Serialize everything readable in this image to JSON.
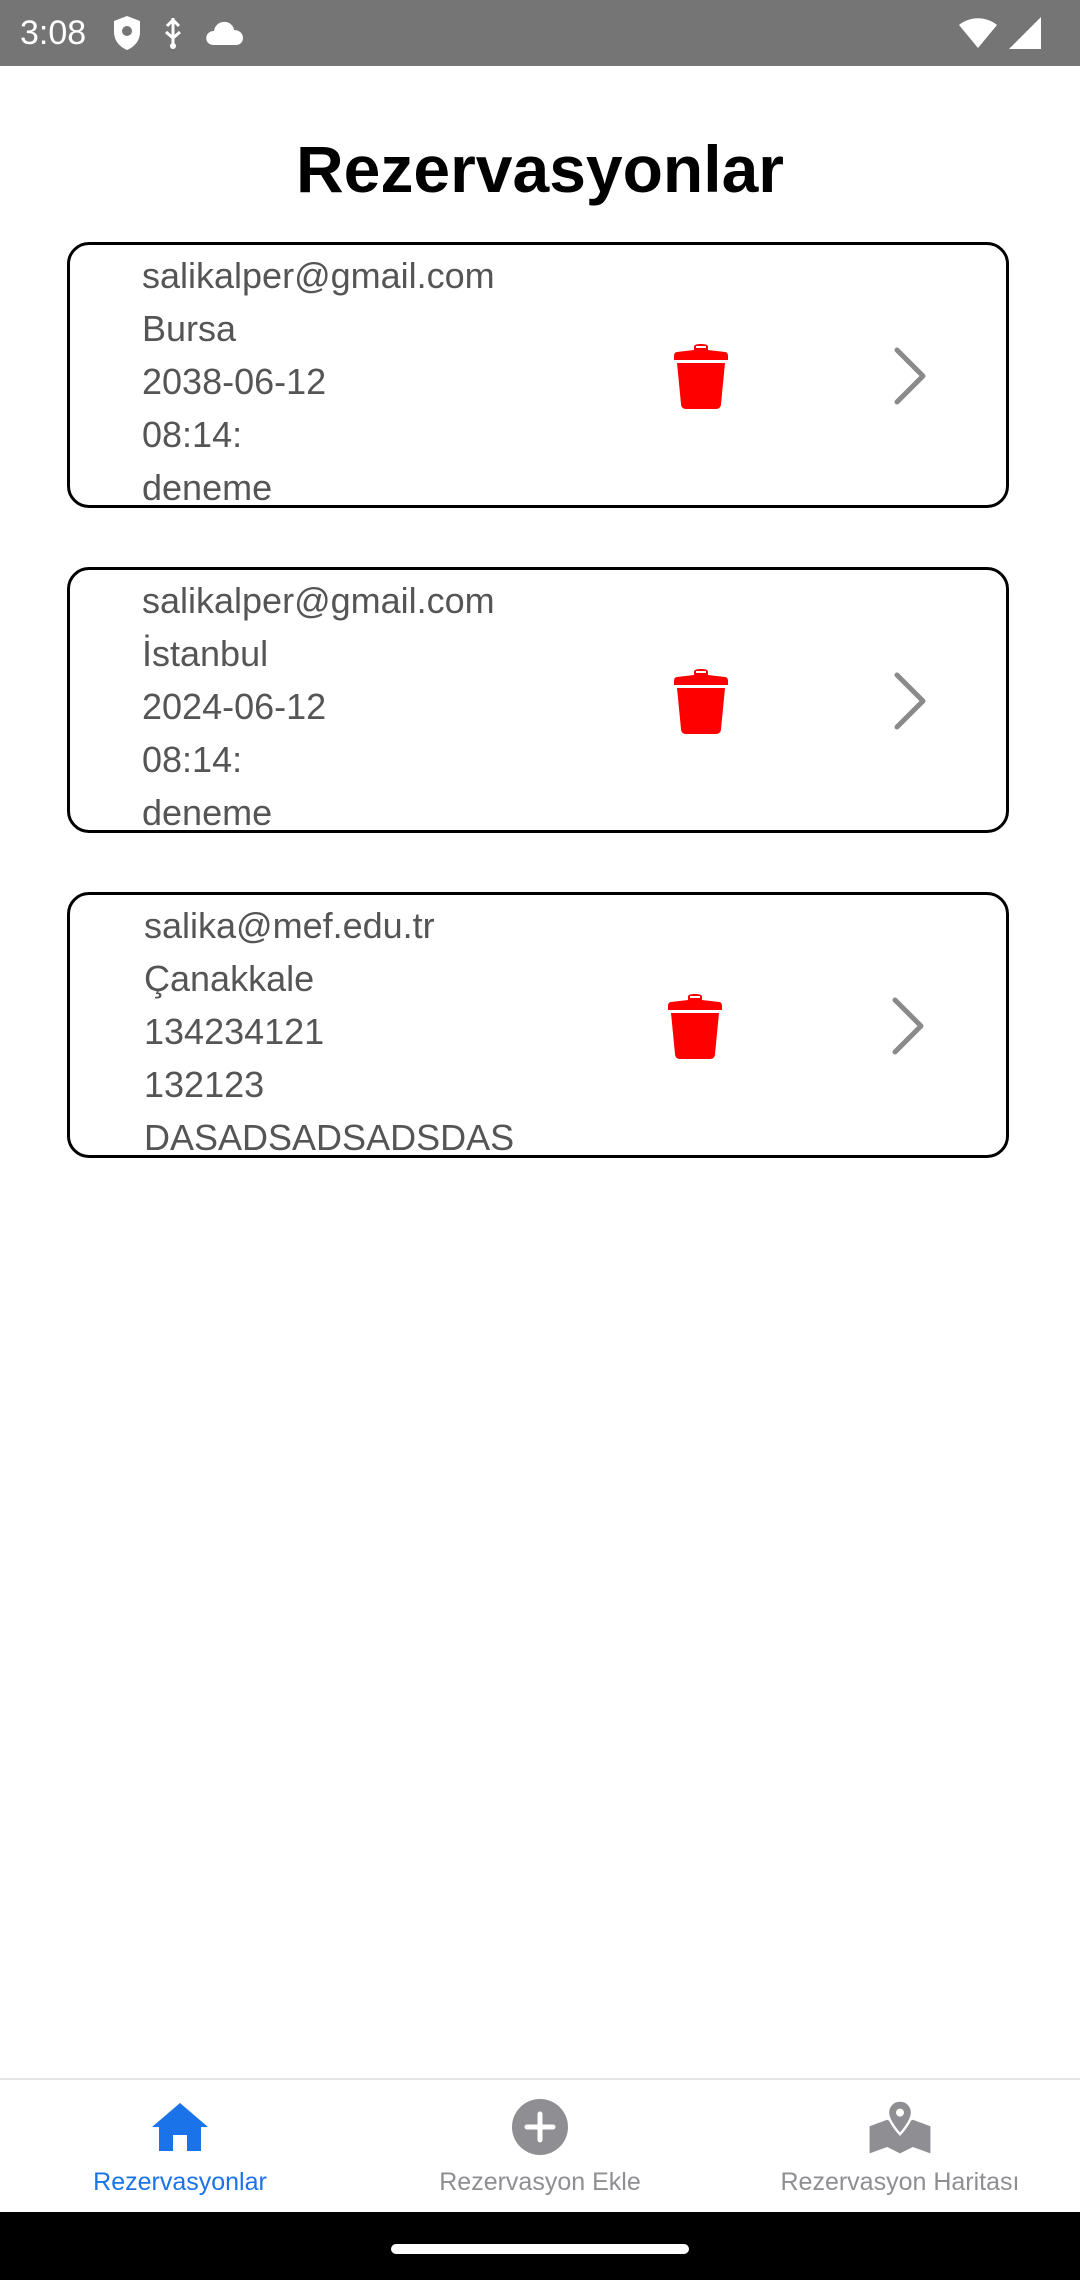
{
  "status_bar": {
    "time": "3:08",
    "icons_left": [
      "shield-icon",
      "usb-debug-icon",
      "cloud-icon"
    ],
    "icons_right": [
      "wifi-icon",
      "cellular-signal-icon"
    ]
  },
  "page": {
    "title": "Rezervasyonlar"
  },
  "reservations": [
    {
      "email": "salikalper@gmail.com",
      "city": "Bursa",
      "date": "2038-06-12",
      "time": "08:14:",
      "note": "deneme"
    },
    {
      "email": "salikalper@gmail.com",
      "city": "İstanbul",
      "date": "2024-06-12",
      "time": "08:14:",
      "note": "deneme"
    },
    {
      "email": "salika@mef.edu.tr",
      "city": "Çanakkale",
      "date": "134234121",
      "time": "132123",
      "note": "DASADSADSADSDAS"
    }
  ],
  "card_icons": {
    "delete": "trash-icon",
    "open": "chevron-right-icon"
  },
  "bottom_nav": {
    "items": [
      {
        "label": "Rezervasyonlar",
        "icon": "home-icon",
        "active": true
      },
      {
        "label": "Rezervasyon Ekle",
        "icon": "add-circle-icon",
        "active": false
      },
      {
        "label": "Rezervasyon Haritası",
        "icon": "map-icon",
        "active": false
      }
    ]
  },
  "colors": {
    "status_bar": "#757575",
    "delete_icon": "#ff0000",
    "active_tab": "#1a73e8",
    "inactive_tab": "#8e8e93",
    "card_text": "#555555"
  }
}
